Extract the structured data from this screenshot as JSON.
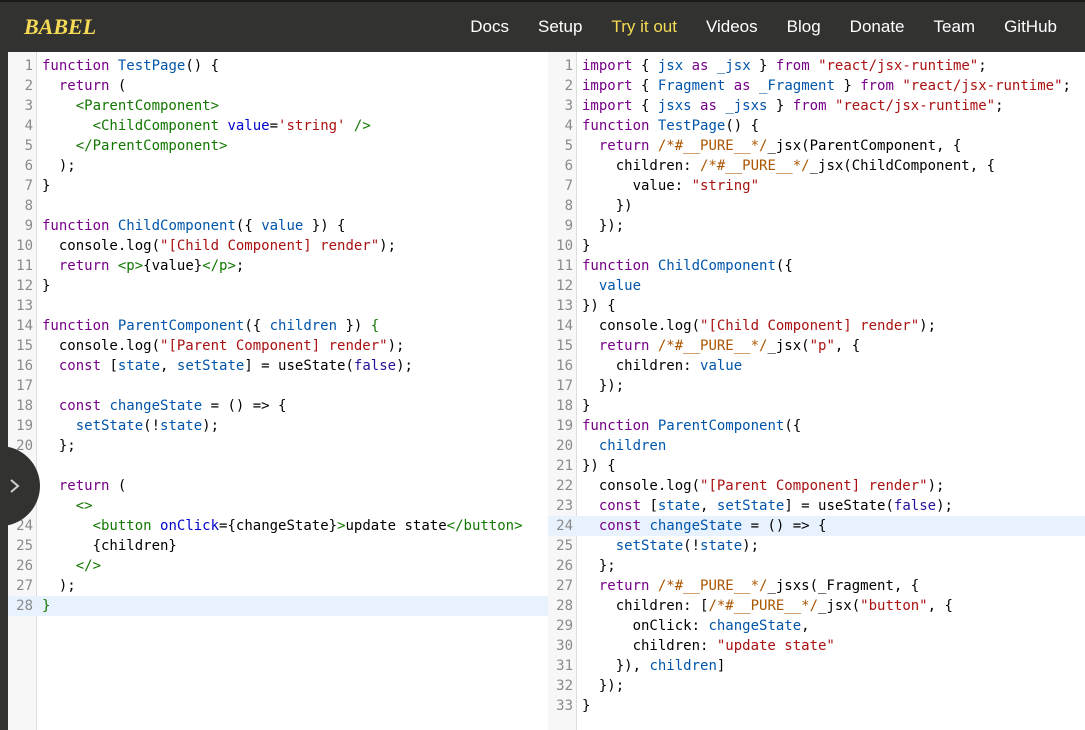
{
  "header": {
    "logo": "BABEL",
    "nav": [
      {
        "label": "Docs",
        "active": false
      },
      {
        "label": "Setup",
        "active": false
      },
      {
        "label": "Try it out",
        "active": true
      },
      {
        "label": "Videos",
        "active": false
      },
      {
        "label": "Blog",
        "active": false
      },
      {
        "label": "Donate",
        "active": false
      },
      {
        "label": "Team",
        "active": false
      },
      {
        "label": "GitHub",
        "active": false
      }
    ]
  },
  "colors": {
    "topbar": "#323330",
    "accent": "#f5da55",
    "highlight_line": "#e8f2ff"
  },
  "sidebar_toggle": {
    "icon": "chevron-right-icon"
  },
  "input_editor": {
    "highlighted_line": 28,
    "lines": [
      [
        [
          "kw",
          "function"
        ],
        [
          "pl",
          " "
        ],
        [
          "def",
          "TestPage"
        ],
        [
          "pl",
          "() {"
        ]
      ],
      [
        [
          "pl",
          "  "
        ],
        [
          "kw",
          "return"
        ],
        [
          "pl",
          " ("
        ]
      ],
      [
        [
          "pl",
          "    "
        ],
        [
          "tag",
          "<ParentComponent>"
        ]
      ],
      [
        [
          "pl",
          "      "
        ],
        [
          "tag",
          "<ChildComponent"
        ],
        [
          "pl",
          " "
        ],
        [
          "attr",
          "value"
        ],
        [
          "pl",
          "="
        ],
        [
          "str",
          "'string'"
        ],
        [
          "pl",
          " "
        ],
        [
          "tag",
          "/>"
        ]
      ],
      [
        [
          "pl",
          "    "
        ],
        [
          "tag",
          "</ParentComponent>"
        ]
      ],
      [
        [
          "pl",
          "  );"
        ]
      ],
      [
        [
          "pl",
          "}"
        ]
      ],
      [],
      [
        [
          "kw",
          "function"
        ],
        [
          "pl",
          " "
        ],
        [
          "def",
          "ChildComponent"
        ],
        [
          "pl",
          "({ "
        ],
        [
          "def",
          "value"
        ],
        [
          "pl",
          " }) {"
        ]
      ],
      [
        [
          "pl",
          "  console.log("
        ],
        [
          "str",
          "\"[Child Component] render\""
        ],
        [
          "pl",
          ");"
        ]
      ],
      [
        [
          "pl",
          "  "
        ],
        [
          "kw",
          "return"
        ],
        [
          "pl",
          " "
        ],
        [
          "tag",
          "<p>"
        ],
        [
          "pl",
          "{value}"
        ],
        [
          "tag",
          "</p>"
        ],
        [
          "pl",
          ";"
        ]
      ],
      [
        [
          "pl",
          "}"
        ]
      ],
      [],
      [
        [
          "kw",
          "function"
        ],
        [
          "pl",
          " "
        ],
        [
          "def",
          "ParentComponent"
        ],
        [
          "pl",
          "({ "
        ],
        [
          "def",
          "children"
        ],
        [
          "pl",
          " }) "
        ],
        [
          "tag",
          "{"
        ]
      ],
      [
        [
          "pl",
          "  console.log("
        ],
        [
          "str",
          "\"[Parent Component] render\""
        ],
        [
          "pl",
          ");"
        ]
      ],
      [
        [
          "pl",
          "  "
        ],
        [
          "kw",
          "const"
        ],
        [
          "pl",
          " ["
        ],
        [
          "def",
          "state"
        ],
        [
          "pl",
          ", "
        ],
        [
          "def",
          "setState"
        ],
        [
          "pl",
          "] = useState("
        ],
        [
          "atom",
          "false"
        ],
        [
          "pl",
          ");"
        ]
      ],
      [],
      [
        [
          "pl",
          "  "
        ],
        [
          "kw",
          "const"
        ],
        [
          "pl",
          " "
        ],
        [
          "def",
          "changeState"
        ],
        [
          "pl",
          " = () => {"
        ]
      ],
      [
        [
          "pl",
          "    "
        ],
        [
          "var",
          "setState"
        ],
        [
          "pl",
          "(!"
        ],
        [
          "var",
          "state"
        ],
        [
          "pl",
          ");"
        ]
      ],
      [
        [
          "pl",
          "  };"
        ]
      ],
      [],
      [
        [
          "pl",
          "  "
        ],
        [
          "kw",
          "return"
        ],
        [
          "pl",
          " ("
        ]
      ],
      [
        [
          "pl",
          "    "
        ],
        [
          "tag",
          "<>"
        ]
      ],
      [
        [
          "pl",
          "      "
        ],
        [
          "tag",
          "<button"
        ],
        [
          "pl",
          " "
        ],
        [
          "attr",
          "onClick"
        ],
        [
          "pl",
          "={changeState}"
        ],
        [
          "tag",
          ">"
        ],
        [
          "pl",
          "update state"
        ],
        [
          "tag",
          "</button>"
        ]
      ],
      [
        [
          "pl",
          "      {children}"
        ]
      ],
      [
        [
          "pl",
          "    "
        ],
        [
          "tag",
          "</>"
        ]
      ],
      [
        [
          "pl",
          "  );"
        ]
      ],
      [
        [
          "tag",
          "}"
        ]
      ]
    ]
  },
  "output_editor": {
    "highlighted_line": 24,
    "lines": [
      [
        [
          "kw",
          "import"
        ],
        [
          "pl",
          " { "
        ],
        [
          "def",
          "jsx"
        ],
        [
          "pl",
          " "
        ],
        [
          "kw",
          "as"
        ],
        [
          "pl",
          " "
        ],
        [
          "def",
          "_jsx"
        ],
        [
          "pl",
          " } "
        ],
        [
          "kw",
          "from"
        ],
        [
          "pl",
          " "
        ],
        [
          "str",
          "\"react/jsx-runtime\""
        ],
        [
          "pl",
          ";"
        ]
      ],
      [
        [
          "kw",
          "import"
        ],
        [
          "pl",
          " { "
        ],
        [
          "def",
          "Fragment"
        ],
        [
          "pl",
          " "
        ],
        [
          "kw",
          "as"
        ],
        [
          "pl",
          " "
        ],
        [
          "def",
          "_Fragment"
        ],
        [
          "pl",
          " } "
        ],
        [
          "kw",
          "from"
        ],
        [
          "pl",
          " "
        ],
        [
          "str",
          "\"react/jsx-runtime\""
        ],
        [
          "pl",
          ";"
        ]
      ],
      [
        [
          "kw",
          "import"
        ],
        [
          "pl",
          " { "
        ],
        [
          "def",
          "jsxs"
        ],
        [
          "pl",
          " "
        ],
        [
          "kw",
          "as"
        ],
        [
          "pl",
          " "
        ],
        [
          "def",
          "_jsxs"
        ],
        [
          "pl",
          " } "
        ],
        [
          "kw",
          "from"
        ],
        [
          "pl",
          " "
        ],
        [
          "str",
          "\"react/jsx-runtime\""
        ],
        [
          "pl",
          ";"
        ]
      ],
      [
        [
          "kw",
          "function"
        ],
        [
          "pl",
          " "
        ],
        [
          "def",
          "TestPage"
        ],
        [
          "pl",
          "() {"
        ]
      ],
      [
        [
          "pl",
          "  "
        ],
        [
          "kw",
          "return"
        ],
        [
          "pl",
          " "
        ],
        [
          "com",
          "/*#__PURE__*/"
        ],
        [
          "pl",
          "_jsx(ParentComponent, {"
        ]
      ],
      [
        [
          "pl",
          "    children: "
        ],
        [
          "com",
          "/*#__PURE__*/"
        ],
        [
          "pl",
          "_jsx(ChildComponent, {"
        ]
      ],
      [
        [
          "pl",
          "      value: "
        ],
        [
          "str",
          "\"string\""
        ]
      ],
      [
        [
          "pl",
          "    })"
        ]
      ],
      [
        [
          "pl",
          "  });"
        ]
      ],
      [
        [
          "pl",
          "}"
        ]
      ],
      [
        [
          "kw",
          "function"
        ],
        [
          "pl",
          " "
        ],
        [
          "def",
          "ChildComponent"
        ],
        [
          "pl",
          "({"
        ]
      ],
      [
        [
          "pl",
          "  "
        ],
        [
          "def",
          "value"
        ]
      ],
      [
        [
          "pl",
          "}) {"
        ]
      ],
      [
        [
          "pl",
          "  console.log("
        ],
        [
          "str",
          "\"[Child Component] render\""
        ],
        [
          "pl",
          ");"
        ]
      ],
      [
        [
          "pl",
          "  "
        ],
        [
          "kw",
          "return"
        ],
        [
          "pl",
          " "
        ],
        [
          "com",
          "/*#__PURE__*/"
        ],
        [
          "pl",
          "_jsx("
        ],
        [
          "str",
          "\"p\""
        ],
        [
          "pl",
          ", {"
        ]
      ],
      [
        [
          "pl",
          "    children: "
        ],
        [
          "var",
          "value"
        ]
      ],
      [
        [
          "pl",
          "  });"
        ]
      ],
      [
        [
          "pl",
          "}"
        ]
      ],
      [
        [
          "kw",
          "function"
        ],
        [
          "pl",
          " "
        ],
        [
          "def",
          "ParentComponent"
        ],
        [
          "pl",
          "({"
        ]
      ],
      [
        [
          "pl",
          "  "
        ],
        [
          "def",
          "children"
        ]
      ],
      [
        [
          "pl",
          "}) {"
        ]
      ],
      [
        [
          "pl",
          "  console.log("
        ],
        [
          "str",
          "\"[Parent Component] render\""
        ],
        [
          "pl",
          ");"
        ]
      ],
      [
        [
          "pl",
          "  "
        ],
        [
          "kw",
          "const"
        ],
        [
          "pl",
          " ["
        ],
        [
          "def",
          "state"
        ],
        [
          "pl",
          ", "
        ],
        [
          "def",
          "setState"
        ],
        [
          "pl",
          "] = useState("
        ],
        [
          "atom",
          "false"
        ],
        [
          "pl",
          ");"
        ]
      ],
      [
        [
          "pl",
          "  "
        ],
        [
          "kw",
          "const"
        ],
        [
          "pl",
          " "
        ],
        [
          "def",
          "changeState"
        ],
        [
          "pl",
          " = () => {"
        ]
      ],
      [
        [
          "pl",
          "    "
        ],
        [
          "var",
          "setState"
        ],
        [
          "pl",
          "(!"
        ],
        [
          "var",
          "state"
        ],
        [
          "pl",
          ");"
        ]
      ],
      [
        [
          "pl",
          "  };"
        ]
      ],
      [
        [
          "pl",
          "  "
        ],
        [
          "kw",
          "return"
        ],
        [
          "pl",
          " "
        ],
        [
          "com",
          "/*#__PURE__*/"
        ],
        [
          "pl",
          "_jsxs(_Fragment, {"
        ]
      ],
      [
        [
          "pl",
          "    children: ["
        ],
        [
          "com",
          "/*#__PURE__*/"
        ],
        [
          "pl",
          "_jsx("
        ],
        [
          "str",
          "\"button\""
        ],
        [
          "pl",
          ", {"
        ]
      ],
      [
        [
          "pl",
          "      onClick: "
        ],
        [
          "var",
          "changeState"
        ],
        [
          "pl",
          ","
        ]
      ],
      [
        [
          "pl",
          "      children: "
        ],
        [
          "str",
          "\"update state\""
        ]
      ],
      [
        [
          "pl",
          "    }), "
        ],
        [
          "var",
          "children"
        ],
        [
          "pl",
          "]"
        ]
      ],
      [
        [
          "pl",
          "  });"
        ]
      ],
      [
        [
          "pl",
          "}"
        ]
      ]
    ]
  }
}
